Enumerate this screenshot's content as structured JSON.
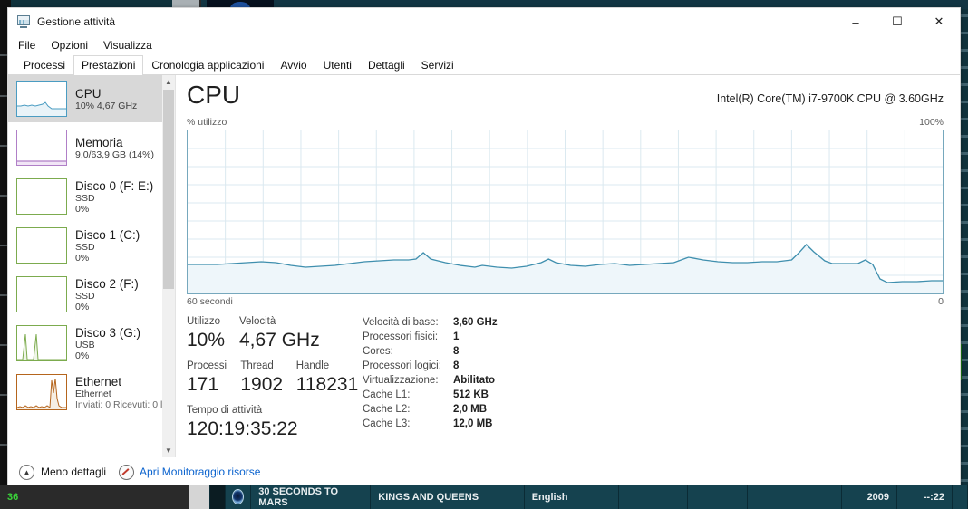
{
  "window": {
    "title": "Gestione attività",
    "icon": "task-manager-icon",
    "minimize": "–",
    "maximize": "☐",
    "close": "✕"
  },
  "menu": [
    "File",
    "Opzioni",
    "Visualizza"
  ],
  "tabs": [
    {
      "label": "Processi",
      "active": false
    },
    {
      "label": "Prestazioni",
      "active": true
    },
    {
      "label": "Cronologia applicazioni",
      "active": false
    },
    {
      "label": "Avvio",
      "active": false
    },
    {
      "label": "Utenti",
      "active": false
    },
    {
      "label": "Dettagli",
      "active": false
    },
    {
      "label": "Servizi",
      "active": false
    }
  ],
  "sidebar": {
    "items": [
      {
        "name": "CPU",
        "line2": "10%  4,67 GHz",
        "line3": "",
        "selected": true,
        "color": "#4a9cc2"
      },
      {
        "name": "Memoria",
        "line2": "9,0/63,9 GB (14%)",
        "line3": "",
        "selected": false,
        "color": "#b07fc7"
      },
      {
        "name": "Disco 0 (F: E:)",
        "line2": "SSD",
        "line3": "0%",
        "selected": false,
        "color": "#7cab4e"
      },
      {
        "name": "Disco 1 (C:)",
        "line2": "SSD",
        "line3": "0%",
        "selected": false,
        "color": "#7cab4e"
      },
      {
        "name": "Disco 2 (F:)",
        "line2": "SSD",
        "line3": "0%",
        "selected": false,
        "color": "#7cab4e"
      },
      {
        "name": "Disco 3 (G:)",
        "line2": "USB",
        "line3": "0%",
        "selected": false,
        "color": "#7cab4e"
      },
      {
        "name": "Ethernet",
        "line2": "Ethernet",
        "line3": "Inviati: 0 Ricevuti: 0 l",
        "selected": false,
        "color": "#b5651d"
      }
    ],
    "scroll_up_icon": "chevron-up-icon",
    "scroll_down_icon": "chevron-down-icon"
  },
  "main": {
    "heading": "CPU",
    "model": "Intel(R) Core(TM) i7-9700K CPU @ 3.60GHz",
    "graph_y_label": "% utilizzo",
    "graph_y_max": "100%",
    "graph_x_label": "60 secondi",
    "graph_x_min": "0",
    "readouts": {
      "utilizzo_label": "Utilizzo",
      "utilizzo_value": "10%",
      "velocita_label": "Velocità",
      "velocita_value": "4,67 GHz",
      "processi_label": "Processi",
      "processi_value": "171",
      "thread_label": "Thread",
      "thread_value": "1902",
      "handle_label": "Handle",
      "handle_value": "118231",
      "uptime_label": "Tempo di attività",
      "uptime_value": "120:19:35:22"
    },
    "specs": [
      {
        "key": "Velocità di base:",
        "value": "3,60 GHz"
      },
      {
        "key": "Processori fisici:",
        "value": "1"
      },
      {
        "key": "Cores:",
        "value": "8"
      },
      {
        "key": "Processori logici:",
        "value": "8"
      },
      {
        "key": "Virtualizzazione:",
        "value": "Abilitato"
      },
      {
        "key": "Cache L1:",
        "value": "512 KB"
      },
      {
        "key": "Cache L2:",
        "value": "2,0 MB"
      },
      {
        "key": "Cache L3:",
        "value": "12,0 MB"
      }
    ]
  },
  "footer": {
    "less_details_icon": "chevron-up-circle-icon",
    "less_details": "Meno dettagli",
    "resource_monitor_icon": "resource-monitor-icon",
    "resource_monitor": "Apri Monitoraggio risorse"
  },
  "player_bar": {
    "counter": "36",
    "disc_icon": "disc-icon",
    "artist": "30 SECONDS TO MARS",
    "title": "KINGS AND QUEENS",
    "language": "English",
    "blank1": "",
    "blank2": "",
    "blank3": "",
    "year": "2009",
    "time": "--:22",
    "blank4": ""
  },
  "colors": {
    "accent_line": "#3f8fae",
    "graph_fill": "#eef6fa",
    "graph_border": "#76a8bd",
    "selected_bg": "#d8d8d8",
    "link": "#0b63ce",
    "desktop": "#10323c"
  },
  "chart_data": {
    "type": "area",
    "title": "CPU",
    "ylabel": "% utilizzo",
    "xlabel": "60 secondi",
    "ylim": [
      0,
      100
    ],
    "xlim": [
      60,
      0
    ],
    "grid": true,
    "x": [
      0,
      2,
      4,
      6,
      8,
      10,
      12,
      14,
      16,
      18,
      20,
      22,
      24,
      26,
      28,
      30,
      32,
      34,
      36,
      38,
      40,
      42,
      44,
      46,
      48,
      50,
      52,
      54,
      56,
      58,
      60,
      62,
      64,
      66,
      68,
      70,
      72,
      74,
      76,
      78,
      80,
      82,
      84,
      86,
      88,
      90,
      92,
      94,
      96,
      98,
      100
    ],
    "values": [
      18,
      18,
      18,
      18,
      18,
      19,
      20,
      20,
      18,
      17,
      18,
      18,
      18,
      19,
      20,
      20,
      21,
      21,
      21,
      25,
      22,
      20,
      19,
      18,
      19,
      18,
      17,
      18,
      18,
      21,
      24,
      21,
      19,
      19,
      20,
      20,
      19,
      20,
      20,
      20,
      20,
      20,
      19,
      20,
      20,
      20,
      21,
      27,
      24,
      21,
      20
    ],
    "tail_values": [
      20,
      20,
      20,
      20,
      8,
      7,
      7,
      7,
      7,
      8,
      8,
      8
    ],
    "series": [
      {
        "name": "% utilizzo CPU",
        "color": "#3f8fae"
      }
    ]
  }
}
